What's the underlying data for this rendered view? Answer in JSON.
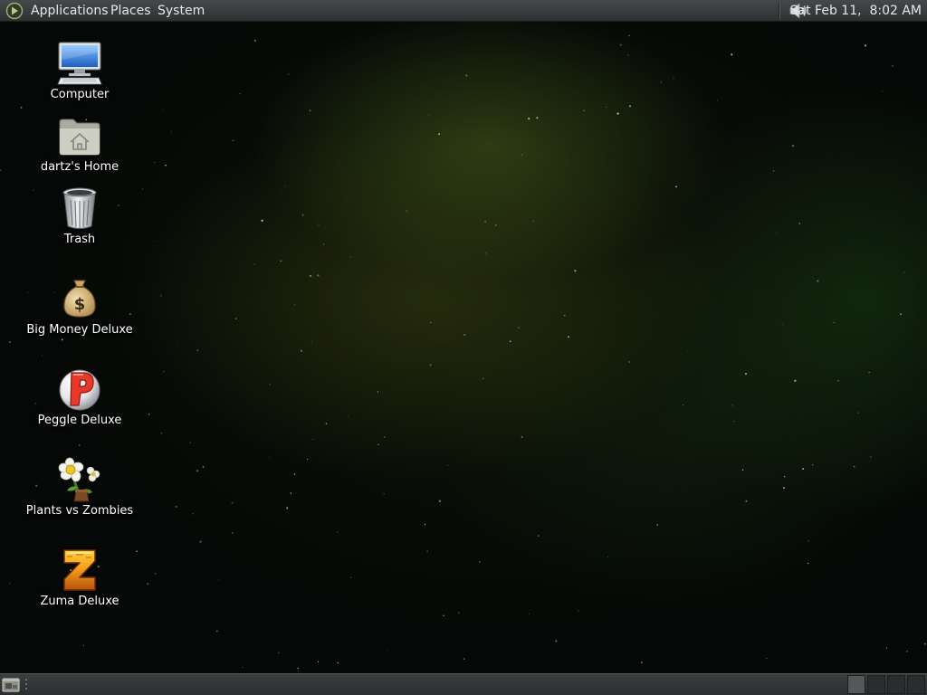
{
  "top_panel": {
    "menus": {
      "applications": "Applications",
      "places": "Places",
      "system": "System"
    },
    "launcher_icon": "gnome-foot-icon",
    "volume_icon": "speaker-volume-icon",
    "clock": "Sat Feb 11,  8:02 AM"
  },
  "desktop": {
    "icons": [
      {
        "label": "Computer",
        "icon": "computer-monitor-icon"
      },
      {
        "label": "dartz's Home",
        "icon": "home-folder-icon"
      },
      {
        "label": "Trash",
        "icon": "trash-can-icon"
      },
      {
        "label": "Big Money Deluxe",
        "icon": "money-bag-icon"
      },
      {
        "label": "Peggle Deluxe",
        "icon": "peggle-p-icon"
      },
      {
        "label": "Plants vs Zombies",
        "icon": "plants-vs-zombies-flower-icon"
      },
      {
        "label": "Zuma Deluxe",
        "icon": "zuma-z-icon"
      }
    ]
  },
  "bottom_panel": {
    "show_desktop_icon": "show-desktop-icon",
    "workspace_count": 4,
    "active_workspace": 1
  },
  "colors": {
    "panel": "#3a3c3e",
    "wallpaper_base": "#050806",
    "wallpaper_glow": "#465f1c",
    "label_text": "#ffffff"
  }
}
